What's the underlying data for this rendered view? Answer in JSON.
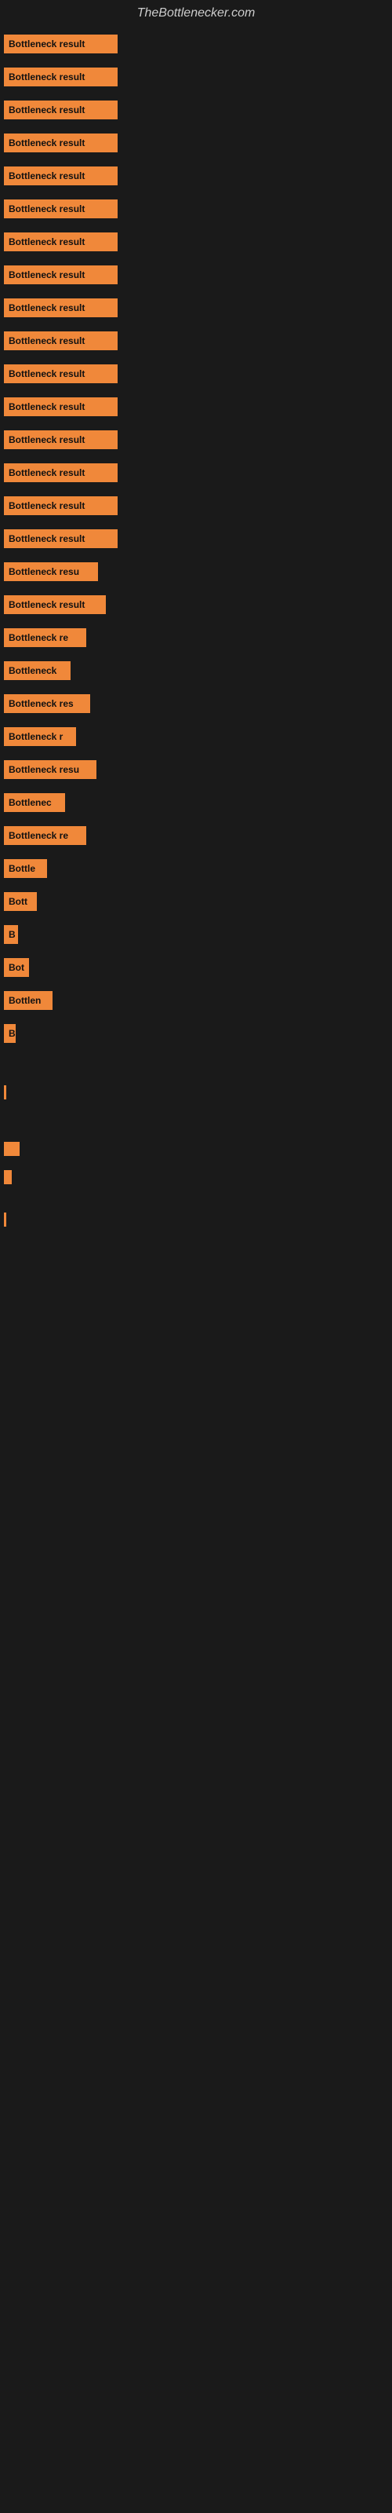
{
  "site": {
    "title": "TheBottlenecker.com"
  },
  "bars": [
    {
      "label": "Bottleneck result",
      "width": 145
    },
    {
      "label": "Bottleneck result",
      "width": 145
    },
    {
      "label": "Bottleneck result",
      "width": 145
    },
    {
      "label": "Bottleneck result",
      "width": 145
    },
    {
      "label": "Bottleneck result",
      "width": 145
    },
    {
      "label": "Bottleneck result",
      "width": 145
    },
    {
      "label": "Bottleneck result",
      "width": 145
    },
    {
      "label": "Bottleneck result",
      "width": 145
    },
    {
      "label": "Bottleneck result",
      "width": 145
    },
    {
      "label": "Bottleneck result",
      "width": 145
    },
    {
      "label": "Bottleneck result",
      "width": 145
    },
    {
      "label": "Bottleneck result",
      "width": 145
    },
    {
      "label": "Bottleneck result",
      "width": 145
    },
    {
      "label": "Bottleneck result",
      "width": 145
    },
    {
      "label": "Bottleneck result",
      "width": 145
    },
    {
      "label": "Bottleneck result",
      "width": 145
    },
    {
      "label": "Bottleneck resu",
      "width": 120
    },
    {
      "label": "Bottleneck result",
      "width": 130
    },
    {
      "label": "Bottleneck re",
      "width": 105
    },
    {
      "label": "Bottleneck",
      "width": 85
    },
    {
      "label": "Bottleneck res",
      "width": 110
    },
    {
      "label": "Bottleneck r",
      "width": 92
    },
    {
      "label": "Bottleneck resu",
      "width": 118
    },
    {
      "label": "Bottlenec",
      "width": 78
    },
    {
      "label": "Bottleneck re",
      "width": 105
    },
    {
      "label": "Bottle",
      "width": 55
    },
    {
      "label": "Bott",
      "width": 42
    },
    {
      "label": "B",
      "width": 18
    },
    {
      "label": "Bot",
      "width": 32
    },
    {
      "label": "Bottlen",
      "width": 62
    },
    {
      "label": "B",
      "width": 15
    },
    {
      "label": "",
      "width": 0
    },
    {
      "label": "",
      "width": 0
    },
    {
      "label": "",
      "width": 3
    },
    {
      "label": "",
      "width": 0
    },
    {
      "label": "",
      "width": 0
    },
    {
      "label": "",
      "width": 20
    },
    {
      "label": "",
      "width": 10
    },
    {
      "label": "",
      "width": 0
    },
    {
      "label": "",
      "width": 3
    }
  ],
  "colors": {
    "background": "#1a1a1a",
    "bar": "#f0883a",
    "title": "#cccccc"
  }
}
